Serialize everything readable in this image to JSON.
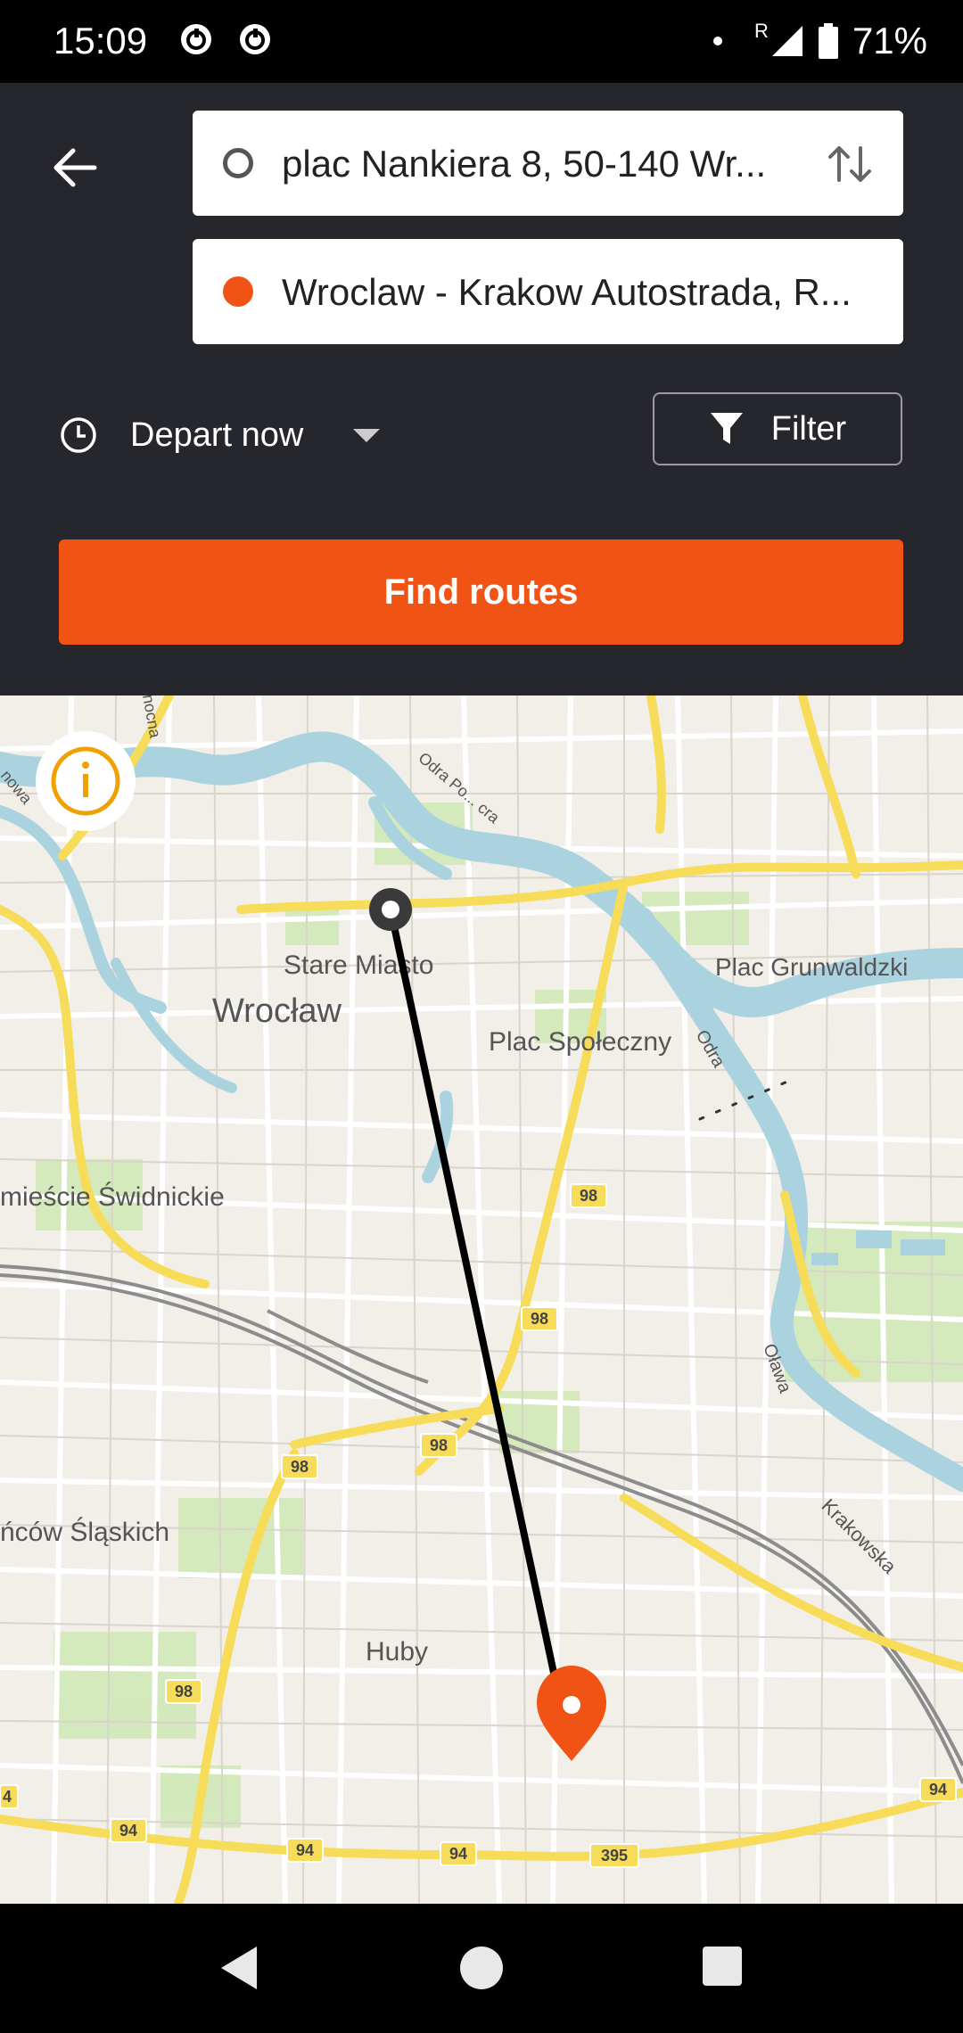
{
  "status_bar": {
    "time": "15:09",
    "roaming": "R",
    "battery": "71%"
  },
  "header": {
    "back_icon": "arrow-left-icon",
    "origin_value": "plac Nankiera 8, 50-140 Wr...",
    "destination_value": "Wroclaw - Krakow Autostrada, R...",
    "swap_icon": "swap-vertical-icon"
  },
  "options": {
    "depart_label": "Depart now",
    "filter_label": "Filter"
  },
  "find_button": "Find routes",
  "map": {
    "labels": {
      "stare_miasto": "Stare Miasto",
      "wroclaw": "Wrocław",
      "plac_spoleczny": "Plac Społeczny",
      "plac_grunwaldzki": "Plac Grunwaldzki",
      "przedmiescie": "mieście Świdnickie",
      "slaskich": "ńców Śląskich",
      "huby": "Huby",
      "odra": "Odra",
      "odra_2": "Odra Po... cra",
      "olawa": "Oława",
      "krakowska": "Krakowska",
      "nowa": "nowa",
      "nocna": "nocna"
    },
    "road_badges": [
      "98",
      "98",
      "98",
      "98",
      "98",
      "94",
      "94",
      "94",
      "94",
      "395",
      "4"
    ],
    "colors": {
      "water": "#aad3df",
      "route_line": "#000000",
      "pin": "#f05313",
      "park": "#c8e6a8"
    }
  }
}
